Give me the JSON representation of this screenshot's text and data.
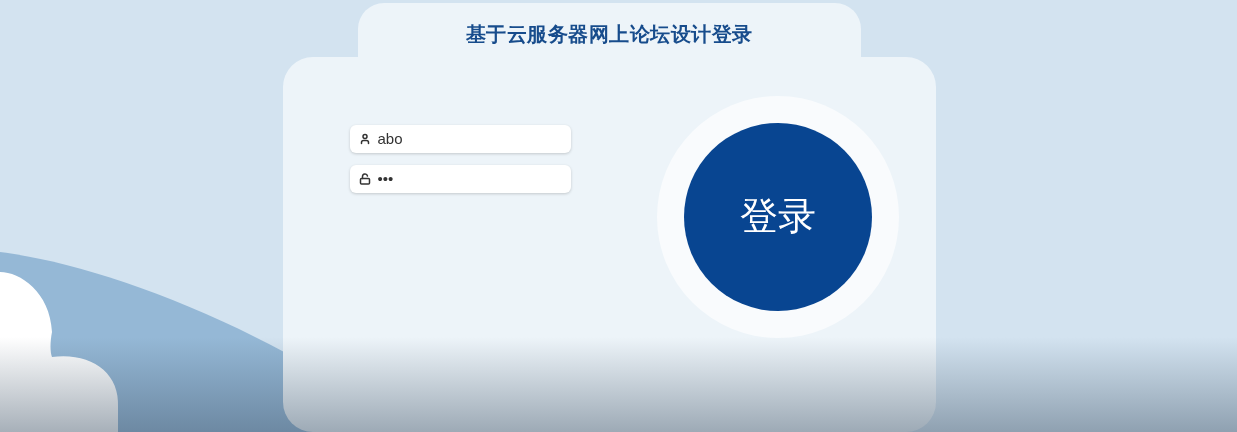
{
  "title": "基于云服务器网上论坛设计登录",
  "fields": [
    {
      "kind": "username",
      "value": "abo"
    },
    {
      "kind": "password",
      "value": "•••"
    }
  ],
  "login_button": {
    "label": "登录"
  }
}
